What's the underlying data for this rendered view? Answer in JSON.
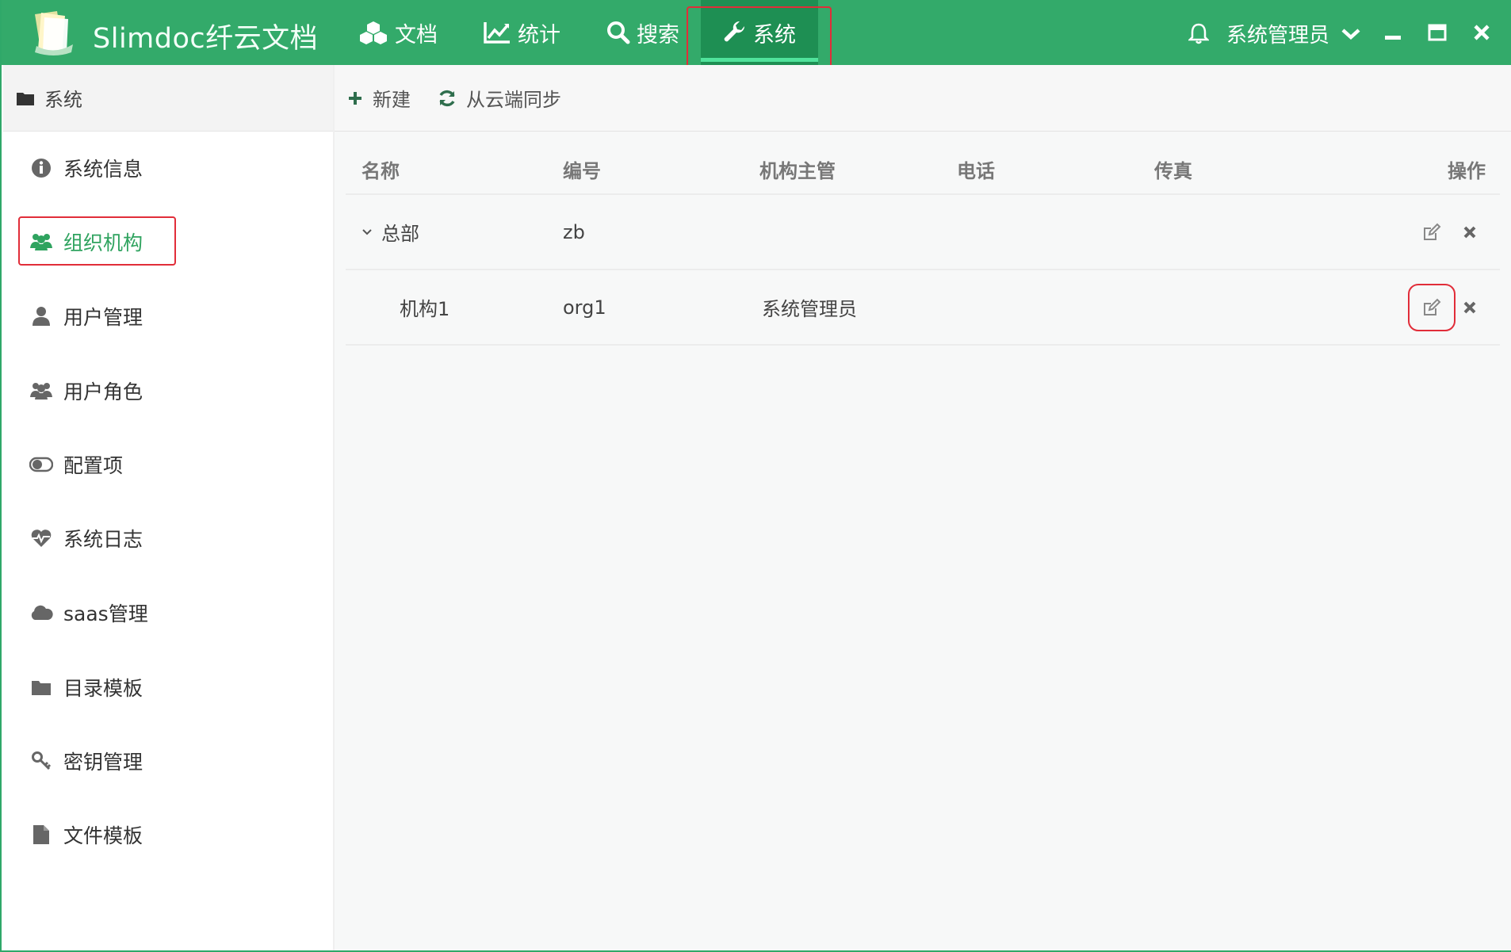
{
  "app": {
    "title": "Slimdoc纤云文档"
  },
  "nav": {
    "tabs": [
      {
        "label": "文档",
        "icon": "cubes-icon"
      },
      {
        "label": "统计",
        "icon": "line-chart-icon"
      },
      {
        "label": "搜索",
        "icon": "search-icon"
      },
      {
        "label": "系统",
        "icon": "wrench-icon",
        "active": true
      }
    ]
  },
  "user": {
    "name": "系统管理员"
  },
  "sidebar": {
    "header": "系统",
    "items": [
      {
        "label": "系统信息",
        "icon": "info-circle-icon"
      },
      {
        "label": "组织机构",
        "icon": "users-icon",
        "active": true
      },
      {
        "label": "用户管理",
        "icon": "user-icon"
      },
      {
        "label": "用户角色",
        "icon": "users-icon"
      },
      {
        "label": "配置项",
        "icon": "toggle-icon"
      },
      {
        "label": "系统日志",
        "icon": "heartbeat-icon"
      },
      {
        "label": "saas管理",
        "icon": "cloud-icon"
      },
      {
        "label": "目录模板",
        "icon": "folder-icon"
      },
      {
        "label": "密钥管理",
        "icon": "key-icon"
      },
      {
        "label": "文件模板",
        "icon": "file-icon"
      }
    ]
  },
  "toolbar": {
    "new_label": "新建",
    "sync_label": "从云端同步"
  },
  "table": {
    "columns": [
      "名称",
      "编号",
      "机构主管",
      "电话",
      "传真",
      "操作"
    ],
    "rows": [
      {
        "name": "总部",
        "code": "zb",
        "manager": "",
        "phone": "",
        "fax": "",
        "expanded": true
      },
      {
        "name": "机构1",
        "code": "org1",
        "manager": "系统管理员",
        "phone": "",
        "fax": ""
      }
    ]
  },
  "colors": {
    "accent": "#33aa6a",
    "active_tab": "#1e8f53",
    "highlight": "#e12d39",
    "sidebar_active": "#2fa35f"
  }
}
